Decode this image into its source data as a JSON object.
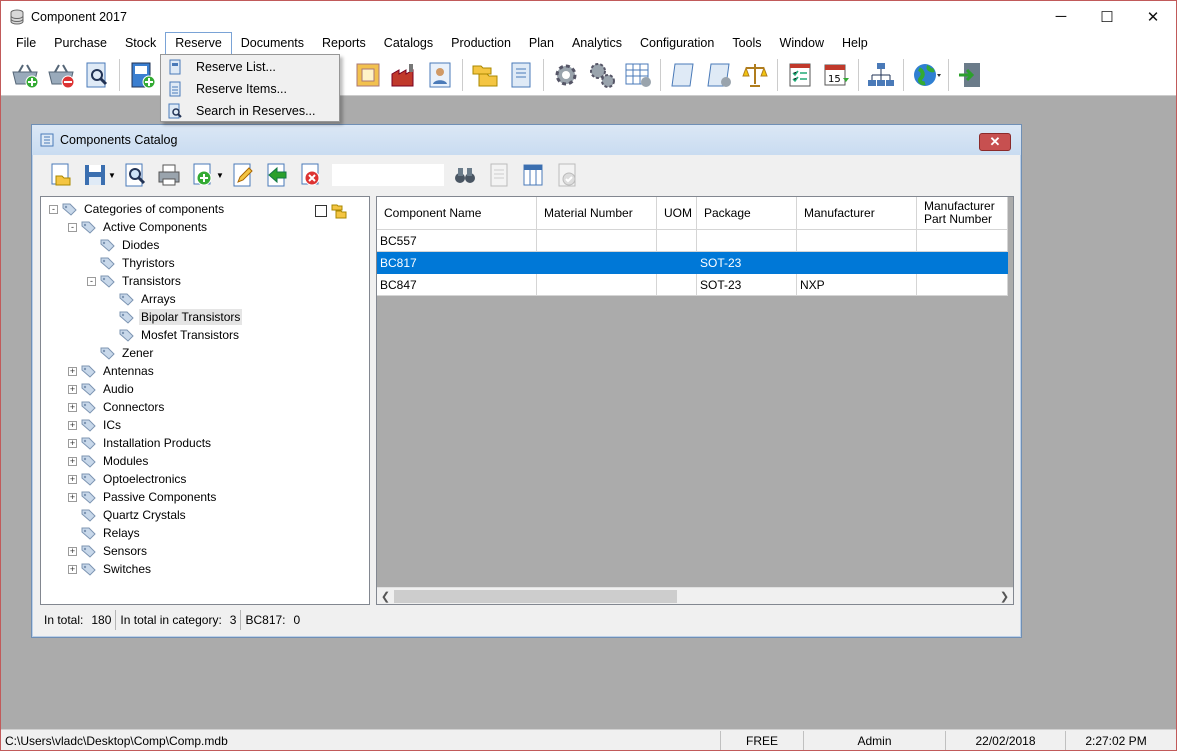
{
  "window": {
    "title": "Component 2017",
    "controls": {
      "minimize": "─",
      "maximize": "☐",
      "close": "✕"
    }
  },
  "menu": [
    "File",
    "Purchase",
    "Stock",
    "Reserve",
    "Documents",
    "Reports",
    "Catalogs",
    "Production",
    "Plan",
    "Analytics",
    "Configuration",
    "Tools",
    "Window",
    "Help"
  ],
  "active_menu": "Reserve",
  "reserve_menu": {
    "items": [
      "Reserve List...",
      "Reserve Items...",
      "Search in Reserves..."
    ]
  },
  "catalog_window": {
    "title": "Components Catalog",
    "close_label": "✕",
    "search_value": "",
    "tree": {
      "root": "Categories of components",
      "items": [
        {
          "label": "Active Components"
        },
        {
          "label": "Diodes"
        },
        {
          "label": "Thyristors"
        },
        {
          "label": "Transistors"
        },
        {
          "label": "Arrays"
        },
        {
          "label": "Bipolar Transistors"
        },
        {
          "label": "Mosfet Transistors"
        },
        {
          "label": "Zener"
        },
        {
          "label": "Antennas"
        },
        {
          "label": "Audio"
        },
        {
          "label": "Connectors"
        },
        {
          "label": "ICs"
        },
        {
          "label": "Installation Products"
        },
        {
          "label": "Modules"
        },
        {
          "label": "Optoelectronics"
        },
        {
          "label": "Passive Components"
        },
        {
          "label": "Quartz Crystals"
        },
        {
          "label": "Relays"
        },
        {
          "label": "Sensors"
        },
        {
          "label": "Switches"
        }
      ]
    },
    "grid": {
      "columns": [
        "Component Name",
        "Material Number",
        "UOM",
        "Package",
        "Manufacturer",
        "Manufacturer\nPart Number"
      ],
      "rows": [
        [
          "BC557",
          "",
          "",
          "",
          "",
          ""
        ],
        [
          "BC817",
          "",
          "",
          "SOT-23",
          "",
          ""
        ],
        [
          "BC847",
          "",
          "",
          "SOT-23",
          "NXP",
          ""
        ]
      ],
      "selected_row": 1
    },
    "status": {
      "total_label": "In total:",
      "total_value": "180",
      "category_label": "In total in category:",
      "category_value": "3",
      "selected_label": "BC817:",
      "selected_value": "0"
    }
  },
  "statusbar": {
    "path": "C:\\Users\\vladc\\Desktop\\Comp\\Comp.mdb",
    "license": "FREE",
    "user": "Admin",
    "date": "22/02/2018",
    "time": "2:27:02 PM"
  },
  "colors": {
    "selection": "#0078d7",
    "workspace": "#ababab",
    "accent_red": "#c75050"
  }
}
